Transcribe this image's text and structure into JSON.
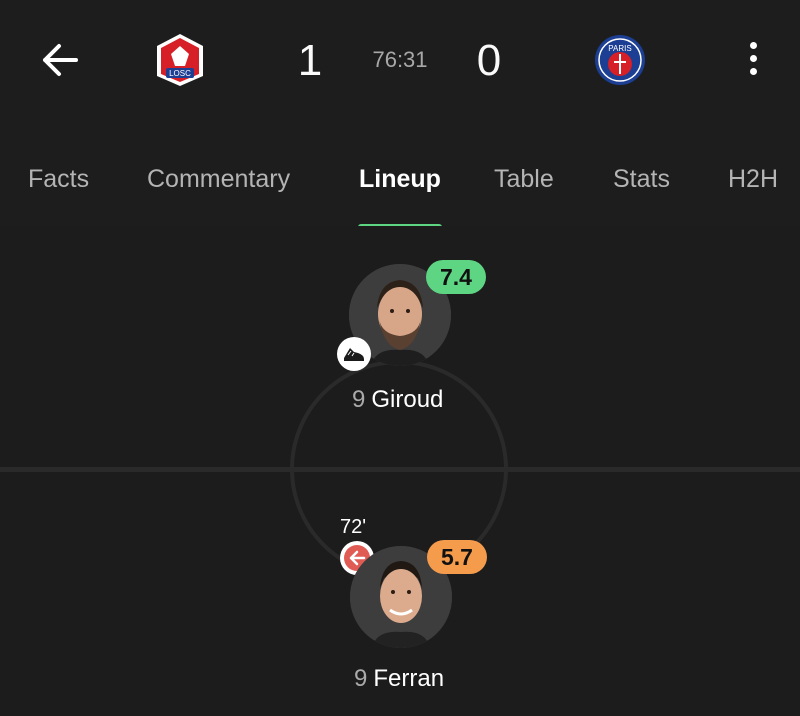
{
  "match": {
    "home_team": "LOSC",
    "away_team": "PARIS",
    "home_score": "1",
    "away_score": "0",
    "clock": "76:31"
  },
  "icons": {
    "back": "arrow-left-icon",
    "more": "more-vertical-icon",
    "goal": "boot-icon",
    "sub_out": "substitution-out-icon"
  },
  "tabs": [
    {
      "label": "Facts"
    },
    {
      "label": "Commentary"
    },
    {
      "label": "Lineup",
      "active": true
    },
    {
      "label": "Table"
    },
    {
      "label": "Stats"
    },
    {
      "label": "H2H"
    }
  ],
  "players": {
    "top": {
      "number": "9",
      "name": "Giroud",
      "rating": "7.4",
      "rating_color": "#5ed583"
    },
    "bottom": {
      "number": "9",
      "name": "Ferran",
      "rating": "5.7",
      "rating_color": "#f59b4c",
      "sub_minute": "72'"
    }
  },
  "colors": {
    "accent": "#5ed583",
    "sub_out": "#e15b55",
    "home_logo": "#d61f26",
    "away_logo": "#1c3f94"
  }
}
